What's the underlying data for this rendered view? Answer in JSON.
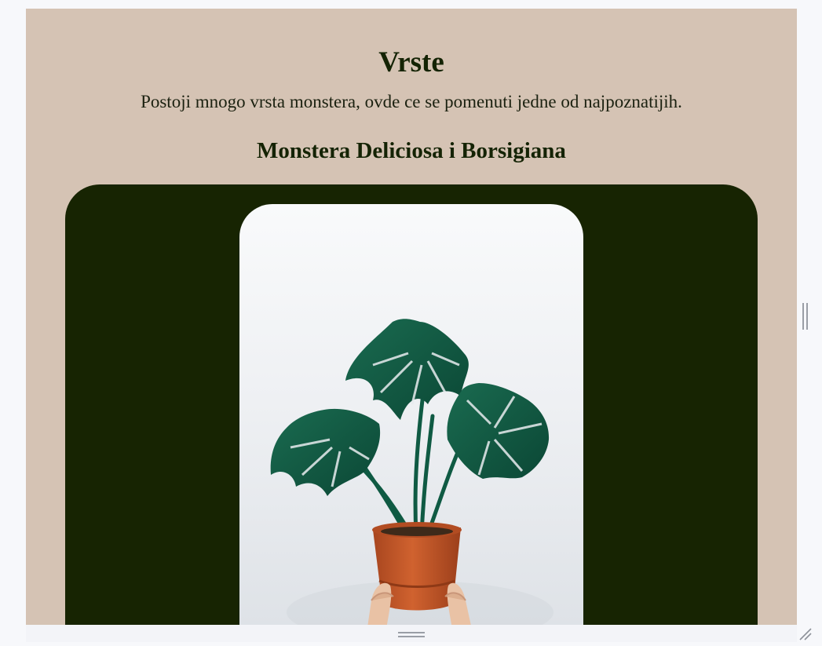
{
  "section": {
    "title": "Vrste",
    "intro": "Postoji mnogo vrsta monstera, ovde ce se pomenuti jedne od najpoznatijih.",
    "subtitle": "Monstera Deliciosa i Borsigiana"
  },
  "image": {
    "subject": "monstera plant in terracotta pot held by hands"
  },
  "colors": {
    "page_background": "#d5c3b4",
    "heading_text": "#142304",
    "card_background": "#172402",
    "leaf_green": "#0f5a43",
    "pot_terracotta": "#c85a2e"
  },
  "icons": {
    "vertical_grip": "drag-handle-vertical-icon",
    "horizontal_grip": "drag-handle-horizontal-icon",
    "resize": "resize-corner-icon"
  }
}
